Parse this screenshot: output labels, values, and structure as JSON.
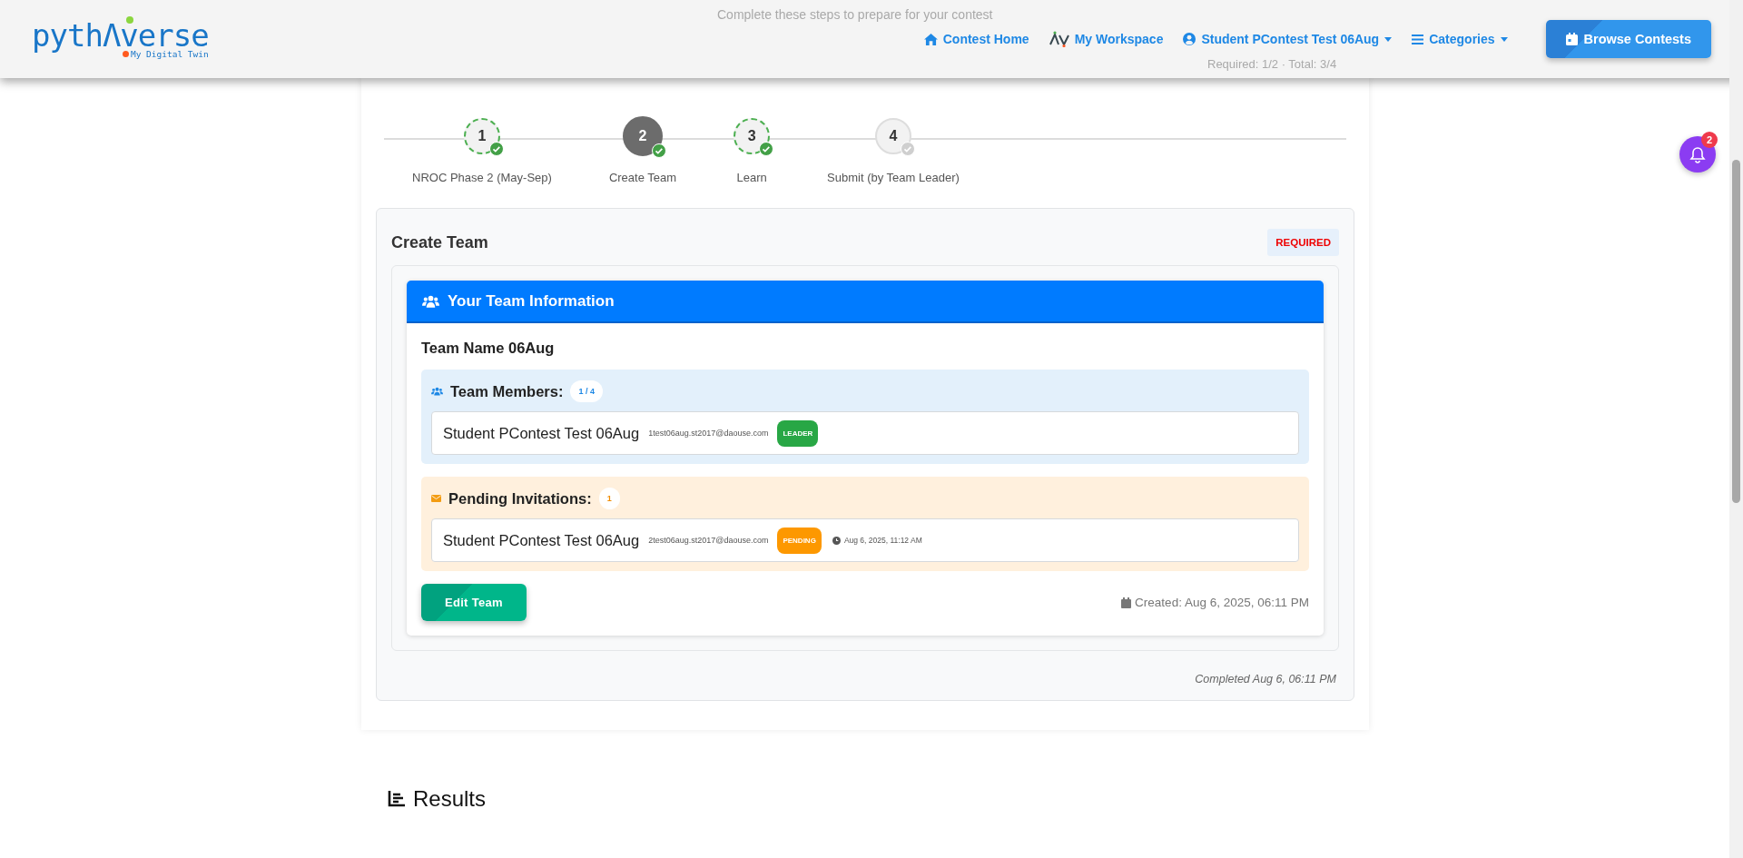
{
  "header": {
    "logo": "pythΛverse",
    "tagline": "My Digital Twin",
    "nav": [
      {
        "label": "Contest Home",
        "dropdown": false
      },
      {
        "label": "My Workspace",
        "dropdown": false
      },
      {
        "label": "Student PContest Test 06Aug",
        "dropdown": true
      },
      {
        "label": "Categories",
        "dropdown": true
      }
    ],
    "button": "Browse Contests"
  },
  "behind_header": {
    "subtitle": "Complete these steps to prepare for your contest",
    "progress": "Required: 1/2 · Total: 3/4"
  },
  "notifications": {
    "count": "2"
  },
  "steps": [
    {
      "number": "1",
      "label": "NROC Phase 2 (May-Sep)",
      "completed": true,
      "selected": false
    },
    {
      "number": "2",
      "label": "Create Team",
      "completed": true,
      "selected": true
    },
    {
      "number": "3",
      "label": "Learn",
      "completed": true,
      "selected": false
    },
    {
      "number": "4",
      "label": "Submit (by Team Leader)",
      "completed": false,
      "selected": false
    }
  ],
  "step_card": {
    "title": "Create Team",
    "badge": "REQUIRED",
    "team_panel": {
      "title": "Your Team Information",
      "team_name": "Team Name 06Aug",
      "members": {
        "title": "Team Members:",
        "count": "1 / 4",
        "rows": [
          {
            "kind": "leader",
            "name": "Student PContest Test 06Aug",
            "email": "1test06aug.st2017@daouse.com",
            "badge": "LEADER"
          }
        ]
      },
      "invitations": {
        "title": "Pending Invitations:",
        "count": "1",
        "rows": [
          {
            "kind": "pending",
            "name": "Student PContest Test 06Aug",
            "email": "2test06aug.st2017@daouse.com",
            "badge": "PENDING",
            "time": "Aug 6, 2025, 11:12 AM"
          }
        ]
      },
      "edit_button": "Edit Team",
      "created": "Created: Aug 6, 2025, 06:11 PM"
    },
    "completed": "Completed Aug 6, 06:11 PM"
  },
  "results": {
    "title": "Results"
  }
}
